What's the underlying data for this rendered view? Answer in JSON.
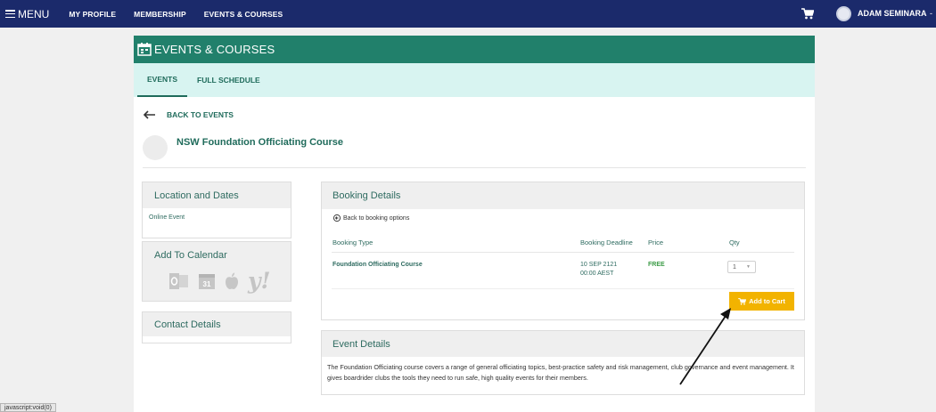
{
  "nav": {
    "menu_label": "MENU",
    "links": [
      "MY PROFILE",
      "MEMBERSHIP",
      "EVENTS & COURSES"
    ],
    "user_name": "ADAM SEMINARA",
    "user_caret": "-"
  },
  "panel": {
    "title": "EVENTS & COURSES",
    "tabs": [
      "EVENTS",
      "FULL SCHEDULE"
    ],
    "back_label": "BACK TO EVENTS",
    "event_title": "NSW Foundation Officiating Course"
  },
  "location": {
    "heading": "Location and Dates",
    "value": "Online Event"
  },
  "calendar": {
    "heading": "Add To Calendar",
    "icons": [
      "outlook-icon",
      "google-calendar-icon",
      "apple-icon",
      "yahoo-icon"
    ],
    "yahoo_glyph": "y!",
    "google_glyph": "31"
  },
  "contact": {
    "heading": "Contact Details"
  },
  "booking": {
    "heading": "Booking Details",
    "back_option": "Back to booking options",
    "columns": [
      "Booking Type",
      "Booking Deadline",
      "Price",
      "Qty"
    ],
    "row": {
      "type": "Foundation Officiating Course",
      "deadline_date": "10 SEP 2121",
      "deadline_time": "00:00 AEST",
      "price": "FREE",
      "qty": "1"
    },
    "add_to_cart": "Add to Cart"
  },
  "details": {
    "heading": "Event Details",
    "text": "The Foundation Officiating course covers a range of general officiating topics, best-practice safety and risk management, club governance and event management. It gives boardrider clubs the tools they need to run safe, high quality events for their members."
  },
  "statusbar": {
    "text": "javascript:void(0)"
  },
  "colors": {
    "navbar": "#1b2a6b",
    "panel_header": "#21806b",
    "tabs_bg": "#d8f4f1",
    "accent_text": "#2e6b60",
    "cart_button": "#f2b300",
    "free_text": "#3a9a45"
  }
}
